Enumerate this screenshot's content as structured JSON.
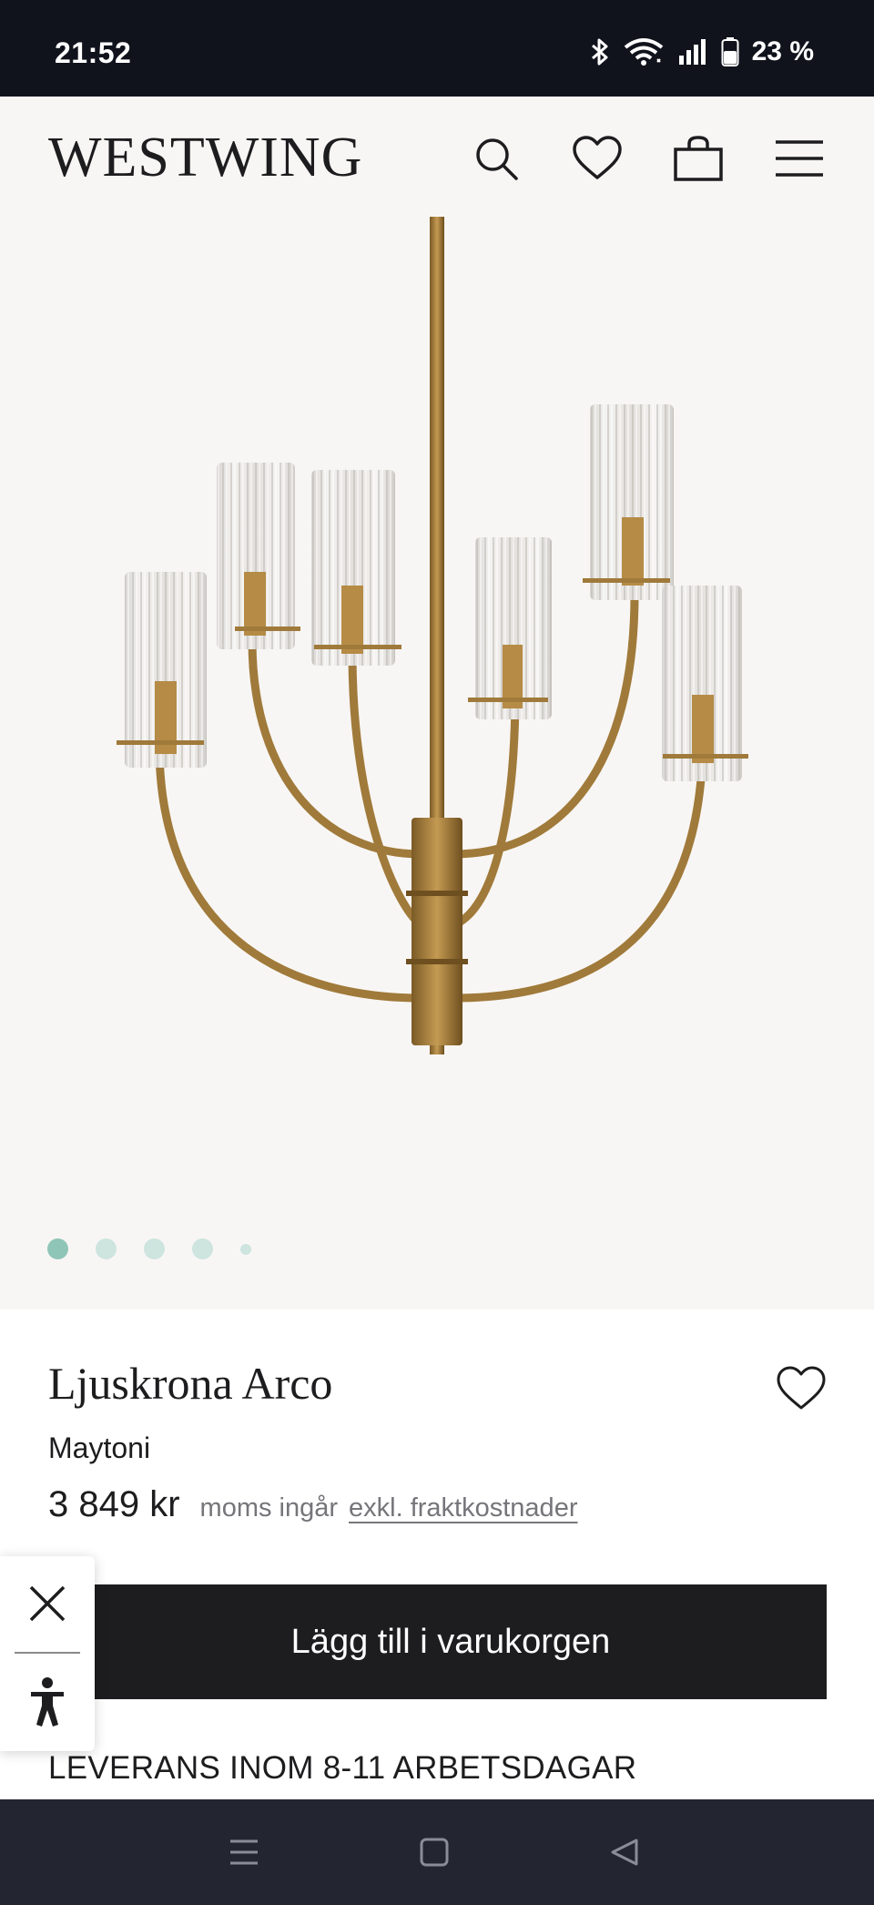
{
  "status_bar": {
    "time": "21:52",
    "battery": "23 %",
    "icons": [
      "bluetooth-icon",
      "wifi-icon",
      "signal-icon",
      "battery-icon"
    ]
  },
  "header": {
    "logo": "WESTWING",
    "icons": [
      "search-icon",
      "heart-icon",
      "shopping-bag-icon",
      "menu-icon"
    ]
  },
  "gallery": {
    "slides": 5,
    "active_slide": 1
  },
  "product": {
    "title": "Ljuskrona Arco",
    "brand": "Maytoni",
    "price": "3 849 kr",
    "vat_note": "moms ingår",
    "shipping_link": "exkl. fraktkostnader",
    "add_to_cart": "Lägg till i varukorgen",
    "delivery": "LEVERANS INOM 8-11 ARBETSDAGAR"
  },
  "accessibility_widget": {
    "icons": [
      "close-icon",
      "accessibility-icon"
    ]
  },
  "nav_bar": {
    "icons": [
      "recent-apps-icon",
      "home-icon",
      "back-icon"
    ]
  },
  "colors": {
    "status_bar_bg": "#11131c",
    "page_bg": "#f8f6f4",
    "button_bg": "#1d1d1f",
    "dot_active": "#8fc5b7",
    "dot_inactive": "#cde4df",
    "nav_bg": "#232631"
  }
}
